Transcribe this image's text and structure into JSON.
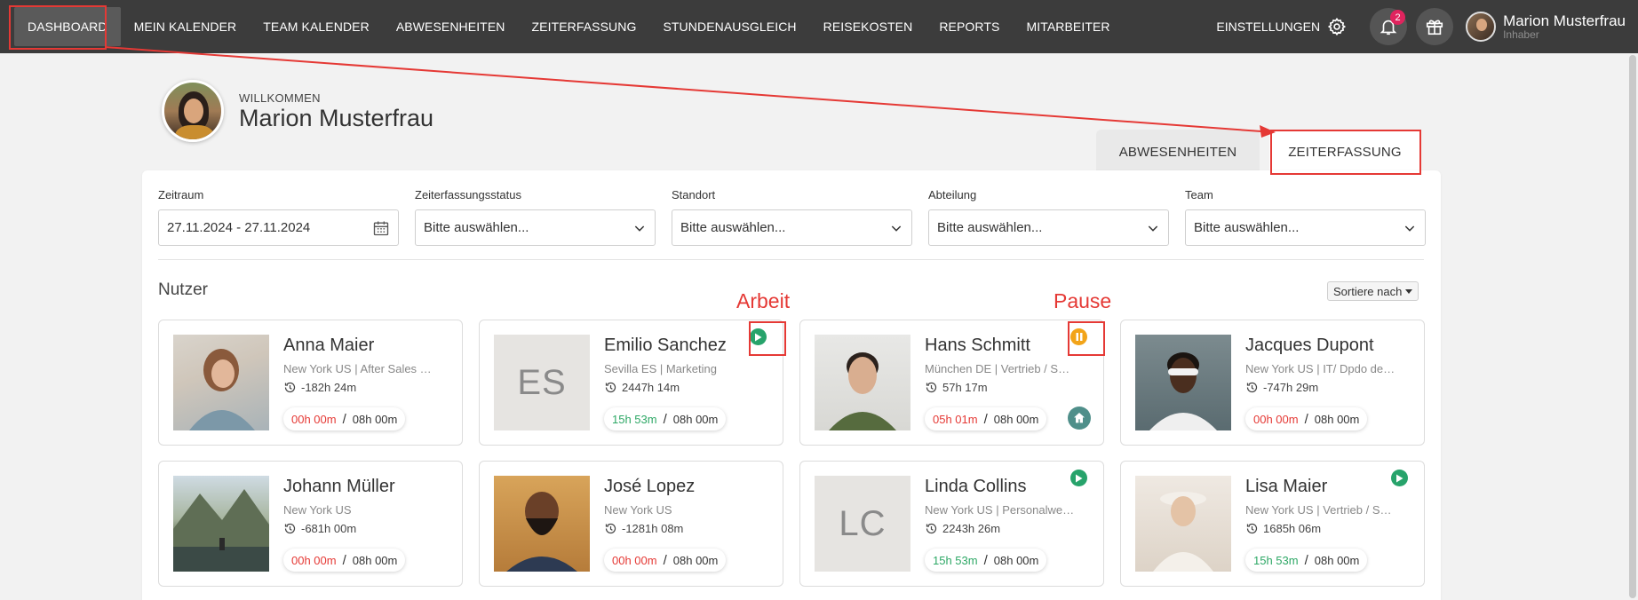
{
  "nav": {
    "items": [
      "DASHBOARD",
      "MEIN KALENDER",
      "TEAM KALENDER",
      "ABWESENHEITEN",
      "ZEITERFASSUNG",
      "STUNDENAUSGLEICH",
      "REISEKOSTEN",
      "REPORTS",
      "MITARBEITER"
    ],
    "settings_label": "EINSTELLUNGEN",
    "notification_count": "2",
    "user_name": "Marion Musterfrau",
    "user_role": "Inhaber"
  },
  "welcome": {
    "label": "WILLKOMMEN",
    "name": "Marion Musterfrau"
  },
  "tabs": {
    "absences": "ABWESENHEITEN",
    "time_tracking": "ZEITERFASSUNG"
  },
  "filters": [
    {
      "label": "Zeitraum",
      "value": "27.11.2024 - 27.11.2024",
      "icon": "calendar-icon"
    },
    {
      "label": "Zeiterfassungsstatus",
      "value": "Bitte auswählen...",
      "icon": "chevron-down-icon"
    },
    {
      "label": "Standort",
      "value": "Bitte auswählen...",
      "icon": "chevron-down-icon"
    },
    {
      "label": "Abteilung",
      "value": "Bitte auswählen...",
      "icon": "chevron-down-icon"
    },
    {
      "label": "Team",
      "value": "Bitte auswählen...",
      "icon": "chevron-down-icon"
    }
  ],
  "users_section": {
    "title": "Nutzer",
    "sort_label": "Sortiere nach"
  },
  "users": [
    {
      "name": "Anna Maier",
      "location": "New York US | After Sales S...",
      "total": "-182h 24m",
      "today": "00h 00m",
      "today_color": "red",
      "target": "08h 00m",
      "status": "",
      "initials": ""
    },
    {
      "name": "Emilio Sanchez",
      "location": "Sevilla ES | Marketing",
      "total": "2447h 14m",
      "today": "15h 53m",
      "today_color": "green",
      "target": "08h 00m",
      "status": "working",
      "initials": "ES"
    },
    {
      "name": "Hans Schmitt",
      "location": "München DE | Vertrieb / Sal...",
      "total": "57h 17m",
      "today": "05h 01m",
      "today_color": "red",
      "target": "08h 00m",
      "status": "pause",
      "initials": ""
    },
    {
      "name": "Jacques Dupont",
      "location": "New York US | IT/ Dpdo de i...",
      "total": "-747h 29m",
      "today": "00h 00m",
      "today_color": "red",
      "target": "08h 00m",
      "status": "",
      "initials": ""
    },
    {
      "name": "Johann Müller",
      "location": "New York US",
      "total": "-681h 00m",
      "today": "00h 00m",
      "today_color": "red",
      "target": "08h 00m",
      "status": "",
      "initials": ""
    },
    {
      "name": "José Lopez",
      "location": "New York US",
      "total": "-1281h 08m",
      "today": "00h 00m",
      "today_color": "red",
      "target": "08h 00m",
      "status": "",
      "initials": ""
    },
    {
      "name": "Linda Collins",
      "location": "New York US | Personalwes...",
      "total": "2243h 26m",
      "today": "15h 53m",
      "today_color": "green",
      "target": "08h 00m",
      "status": "working",
      "initials": "LC"
    },
    {
      "name": "Lisa Maier",
      "location": "New York US | Vertrieb / Sal...",
      "total": "1685h 06m",
      "today": "15h 53m",
      "today_color": "green",
      "target": "08h 00m",
      "status": "working",
      "initials": ""
    }
  ],
  "annotations": {
    "work_label": "Arbeit",
    "pause_label": "Pause",
    "color": "#e53935"
  },
  "colors": {
    "topbar": "#3c3c3c",
    "green": "#2ea866",
    "red": "#e53935",
    "pause": "#f2a419",
    "home_office": "#4f8f8a"
  }
}
